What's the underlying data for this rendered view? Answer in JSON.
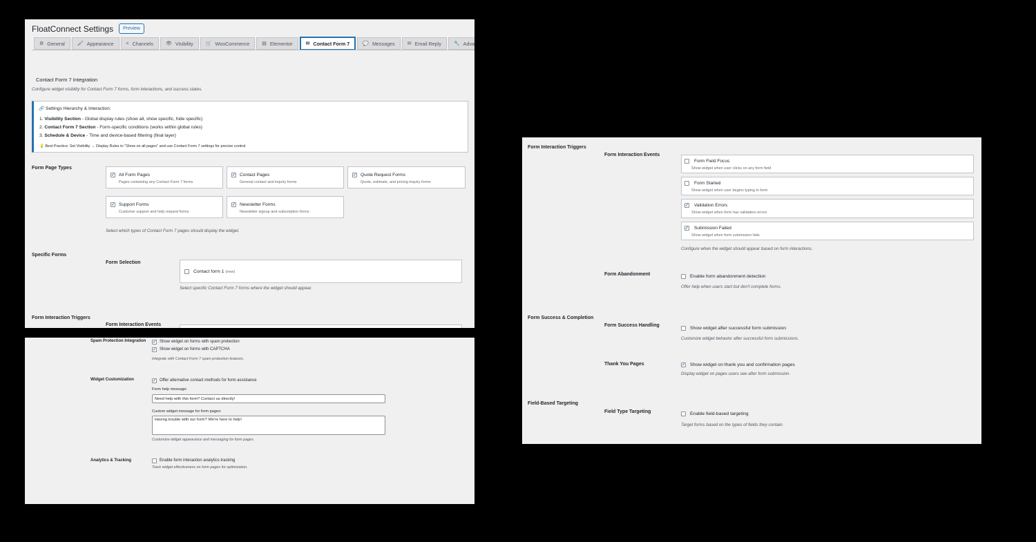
{
  "settings": {
    "title": "FloatConnect Settings",
    "preview": "Preview",
    "tabs": [
      {
        "icon": "⚙",
        "label": "General"
      },
      {
        "icon": "🖌",
        "label": "Appearance"
      },
      {
        "icon": "<",
        "label": "Channels"
      },
      {
        "icon": "👁",
        "label": "Visibility"
      },
      {
        "icon": "🛒",
        "label": "WooCommerce"
      },
      {
        "icon": "▤",
        "label": "Elementor"
      },
      {
        "icon": "✉",
        "label": "Contact Form 7"
      },
      {
        "icon": "💬",
        "label": "Messages"
      },
      {
        "icon": "✉",
        "label": "Email Reply"
      },
      {
        "icon": "🔧",
        "label": "Advanced"
      }
    ],
    "active_tab": "Contact Form 7"
  },
  "cf7": {
    "section_title": "Contact Form 7 Integration",
    "section_desc": "Configure widget visibility for Contact Form 7 forms, form interactions, and success states.",
    "hierarchy": {
      "title": "🔗 Settings Hierarchy & Interaction:",
      "items": [
        {
          "num": "1.",
          "bold": "Visibility Section",
          "text": " - Global display rules (show all, show specific, hide specific)"
        },
        {
          "num": "2.",
          "bold": "Contact Form 7 Section",
          "text": " - Form-specific conditions (works within global rules)"
        },
        {
          "num": "3.",
          "bold": "Schedule & Device",
          "text": " - Time and device-based filtering (final layer)"
        }
      ],
      "note": "💡 Best Practice: Set Visibility → Display Rules to \"Show on all pages\" and use Contact Form 7 settings for precise control."
    },
    "form_page_types": {
      "label": "Form Page Types",
      "options": [
        {
          "title": "All Form Pages",
          "desc": "Pages containing any Contact Form 7 forms",
          "checked": "✓"
        },
        {
          "title": "Contact Pages",
          "desc": "General contact and inquiry forms",
          "checked": "✓"
        },
        {
          "title": "Quote Request Forms",
          "desc": "Quote, estimate, and pricing inquiry forms",
          "checked": "✓"
        },
        {
          "title": "Support Forms",
          "desc": "Customer support and help request forms",
          "checked": "✓"
        },
        {
          "title": "Newsletter Forms",
          "desc": "Newsletter signup and subscription forms",
          "checked": "✓"
        }
      ],
      "help": "Select which types of Contact Form 7 pages should display the widget."
    },
    "specific_forms": {
      "label": "Specific Forms",
      "sub_label": "Form Selection",
      "form_name": "Contact form 1",
      "form_tag": "(new)",
      "help": "Select specific Contact Form 7 forms where the widget should appear."
    },
    "triggers_label": "Form Interaction Triggers",
    "events_label": "Form Interaction Events"
  },
  "lower": {
    "spam": {
      "label": "Spam Protection Integration",
      "opt1": "Show widget on forms with spam protection",
      "opt2": "Show widget on forms with CAPTCHA",
      "help": "Integrate with Contact Form 7 spam protection features."
    },
    "custom": {
      "label": "Widget Customization",
      "opt": "Offer alternative contact methods for form assistance",
      "help_msg_label": "Form help message:",
      "help_msg_value": "Need help with this form? Contact us directly!",
      "custom_msg_label": "Custom widget message for form pages:",
      "custom_msg_value": "Having trouble with our form? We're here to help!",
      "help": "Customize widget appearance and messaging for form pages."
    },
    "analytics": {
      "label": "Analytics & Tracking",
      "opt": "Enable form interaction analytics tracking",
      "help": "Track widget effectiveness on form pages for optimization."
    },
    "check": "✓"
  },
  "right": {
    "triggers_label": "Form Interaction Triggers",
    "events_label": "Form Interaction Events",
    "events": [
      {
        "title": "Form Field Focus",
        "desc": "Show widget when user clicks on any form field",
        "checked": ""
      },
      {
        "title": "Form Started",
        "desc": "Show widget when user begins typing in form",
        "checked": ""
      },
      {
        "title": "Validation Errors",
        "desc": "Show widget when form has validation errors",
        "checked": "✓"
      },
      {
        "title": "Submission Failed",
        "desc": "Show widget when form submission fails",
        "checked": "✓"
      }
    ],
    "events_help": "Configure when the widget should appear based on form interactions.",
    "abandon_label": "Form Abandonment",
    "abandon_opt": "Enable form abandonment detection",
    "abandon_help": "Offer help when users start but don't complete forms.",
    "success_label": "Form Success & Completion",
    "success_handling_label": "Form Success Handling",
    "success_opt": "Show widget after successful form submission",
    "success_help": "Customize widget behavior after successful form submissions.",
    "thankyou_label": "Thank You Pages",
    "thankyou_opt": "Show widget on thank you and confirmation pages",
    "thankyou_check": "✓",
    "thankyou_help": "Display widget on pages users see after form submission.",
    "field_label": "Field-Based Targeting",
    "field_type_label": "Field Type Targeting",
    "field_opt": "Enable field-based targeting",
    "field_help": "Target forms based on the types of fields they contain."
  }
}
